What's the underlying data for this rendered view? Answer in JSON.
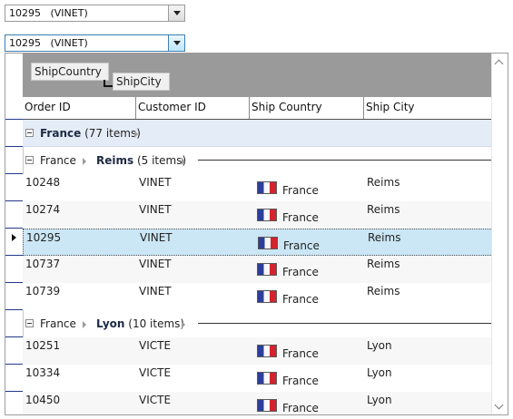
{
  "combo1": {
    "value": "10295   (VINET)"
  },
  "combo2": {
    "value": "10295   (VINET)"
  },
  "group_panel": {
    "chips": [
      "ShipCountry",
      "ShipCity"
    ]
  },
  "columns": [
    "Order ID",
    "Customer ID",
    "Ship Country",
    "Ship City"
  ],
  "groups": {
    "france": {
      "name": "France",
      "count": "(77 items)"
    },
    "reims": {
      "parent": "France",
      "name": "Reims",
      "count": "(5 items)"
    },
    "lyon": {
      "parent": "France",
      "name": "Lyon",
      "count": "(10 items)"
    }
  },
  "rows": [
    {
      "order_id": "10248",
      "customer_id": "VINET",
      "ship_country": "France",
      "ship_city": "Reims"
    },
    {
      "order_id": "10274",
      "customer_id": "VINET",
      "ship_country": "France",
      "ship_city": "Reims"
    },
    {
      "order_id": "10295",
      "customer_id": "VINET",
      "ship_country": "France",
      "ship_city": "Reims"
    },
    {
      "order_id": "10737",
      "customer_id": "VINET",
      "ship_country": "France",
      "ship_city": "Reims"
    },
    {
      "order_id": "10739",
      "customer_id": "VINET",
      "ship_country": "France",
      "ship_city": "Reims"
    },
    {
      "order_id": "10251",
      "customer_id": "VICTE",
      "ship_country": "France",
      "ship_city": "Lyon"
    },
    {
      "order_id": "10334",
      "customer_id": "VICTE",
      "ship_country": "France",
      "ship_city": "Lyon"
    },
    {
      "order_id": "10450",
      "customer_id": "VICTE",
      "ship_country": "France",
      "ship_city": "Lyon"
    }
  ],
  "selected_order_id": "10295",
  "flag_icon": "france-flag-icon"
}
